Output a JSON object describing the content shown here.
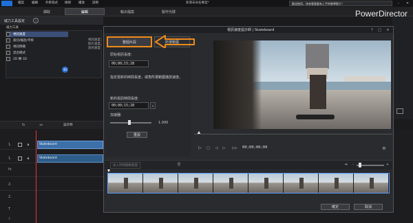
{
  "window": {
    "menu": [
      "檔案",
      "編輯",
      "外掛程式",
      "檢視",
      "播放",
      "說明"
    ],
    "title": "新增未命名專案*",
    "notice": "歡迎使用，快來看看載有上手的教學影片！"
  },
  "top_tabs": [
    "擷取",
    "編輯",
    "輸出檔案",
    "製作光碟"
  ],
  "brand": "PowerDirector",
  "tool_panel": {
    "title": "威力工具設定",
    "group_label": "威力工具",
    "items": [
      "視訊速度",
      "裁切/縮放/平移",
      "視訊倒播",
      "混合模式",
      "2D 轉 3D"
    ],
    "description": "視訊速度：擷取片速度，播放的速度"
  },
  "timeline": {
    "designer_label": "設計師",
    "tracks": [
      "1.",
      "1.",
      "fx",
      "2.",
      "2.",
      "T",
      "♪"
    ],
    "clip_video": "Skateboard",
    "clip_audio": "Skateboard"
  },
  "dialog": {
    "title": "視訊速度設計師 | Skateboard",
    "tabs": [
      "整個片段",
      "所選範圍"
    ],
    "original_label": "原始視訊長度:",
    "original_value": "00;00;15;28",
    "hint": "指定需新的時間長度，或角所選範圍播放速度。",
    "new_label": "新的視訊時間長度:",
    "new_value": "00;00;15;28",
    "multiplier_label": "加速器:",
    "multiplier_value": "1.000",
    "reset": "重設",
    "timecode": "00;00;00;00",
    "add_speed": "加入時間變數範圍",
    "ok": "確定",
    "cancel": "取消"
  }
}
